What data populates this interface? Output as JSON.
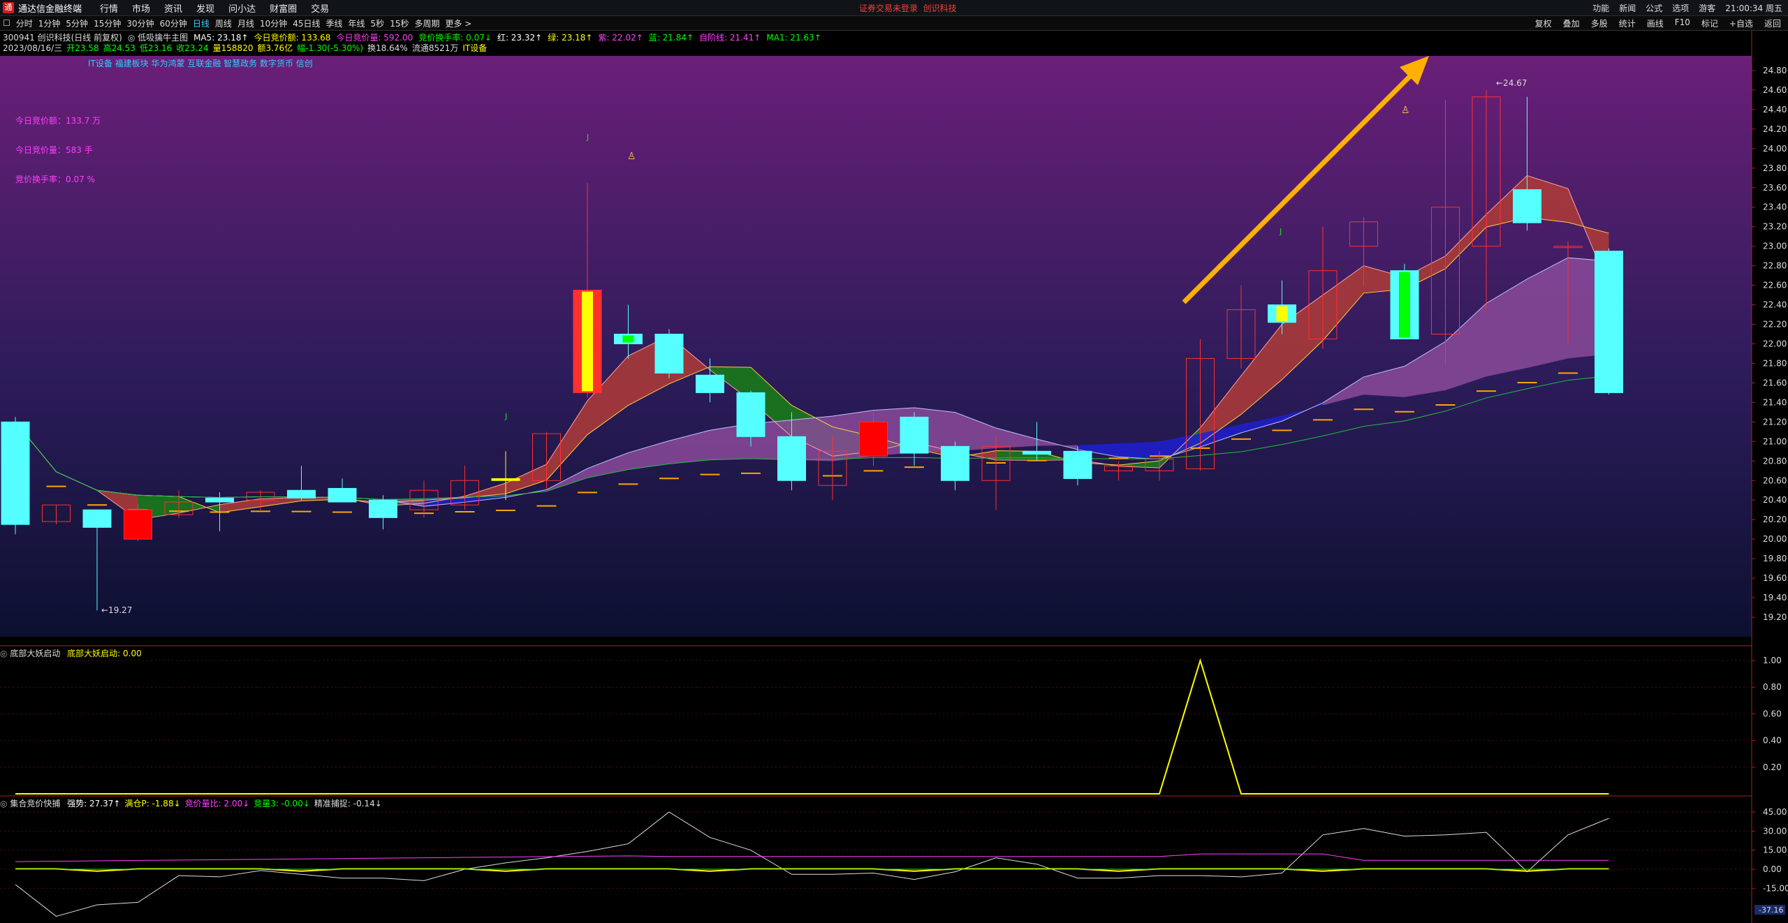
{
  "app": {
    "title": "通达信金融终端",
    "menu": [
      "行情",
      "市场",
      "资讯",
      "发现",
      "问小达",
      "财富圈",
      "交易"
    ],
    "notice": "证券交易未登录",
    "notice2": "创识科技",
    "right_items": [
      "功能",
      "新闻",
      "公式",
      "选项",
      "游客",
      "21:00:34 周五"
    ]
  },
  "periods": {
    "items": [
      "分时",
      "1分钟",
      "5分钟",
      "15分钟",
      "30分钟",
      "60分钟",
      "日线",
      "周线",
      "月线",
      "10分钟",
      "45日线",
      "季线",
      "年线",
      "5秒",
      "15秒",
      "多周期",
      "更多 >"
    ],
    "selected": "日线",
    "right": [
      "复权",
      "叠加",
      "多股",
      "统计",
      "画线",
      "F10",
      "标记",
      "+自选",
      "返回"
    ]
  },
  "info": {
    "line1": [
      {
        "text": "300941 创识科技(日线 前复权)",
        "color": "#dddddd"
      },
      {
        "text": "◎ 低吸擒牛主图",
        "color": "#dddddd"
      },
      {
        "text": "MA5: 23.18↑",
        "color": "#ffffff"
      },
      {
        "text": "今日竞价额: 133.68",
        "color": "#ffff00"
      },
      {
        "text": "今日竞价量: 592.00",
        "color": "#ff40ff"
      },
      {
        "text": "竞价换手率: 0.07↓",
        "color": "#00ff00"
      },
      {
        "text": "红: 23.32↑",
        "color": "#ffffff"
      },
      {
        "text": "绿: 23.18↑",
        "color": "#ffff00"
      },
      {
        "text": "紫: 22.02↑",
        "color": "#ff40ff"
      },
      {
        "text": "蓝: 21.84↑",
        "color": "#00ff00"
      },
      {
        "text": "自阶线: 21.41↑",
        "color": "#ff40ff"
      },
      {
        "text": "MA1: 21.63↑",
        "color": "#00ff00"
      }
    ],
    "line2": [
      {
        "text": "2023/08/16/三",
        "color": "#dddddd"
      },
      {
        "text": "开23.58",
        "color": "#00ff00"
      },
      {
        "text": "高24.53",
        "color": "#00ff00"
      },
      {
        "text": "低23.16",
        "color": "#00ff00"
      },
      {
        "text": "收23.24",
        "color": "#00ff00"
      },
      {
        "text": "量158820",
        "color": "#ffff00"
      },
      {
        "text": "额3.76亿",
        "color": "#ffff00"
      },
      {
        "text": "幅-1.30(-5.30%)",
        "color": "#00ff00"
      },
      {
        "text": "换18.64%",
        "color": "#dddddd"
      },
      {
        "text": "流通8521万",
        "color": "#dddddd"
      },
      {
        "text": "IT设备",
        "color": "#ffff00"
      }
    ],
    "concepts": "IT设备 福建板块 华为鸿蒙 互联金融 智慧政务 数字货币 信创"
  },
  "side_stats": [
    {
      "label": "今日竞价额：133.7 万"
    },
    {
      "label": "今日竞价量：583 手"
    },
    {
      "label": "竞价换手率：0.07 %"
    }
  ],
  "main_chart": {
    "ylim": [
      19.0,
      24.95
    ],
    "y_ticks": [
      "24.80",
      "24.60",
      "24.40",
      "24.20",
      "24.00",
      "23.80",
      "23.60",
      "23.40",
      "23.20",
      "23.00",
      "22.80",
      "22.60",
      "22.40",
      "22.20",
      "22.00",
      "21.80",
      "21.60",
      "21.40",
      "21.20",
      "21.00",
      "20.80",
      "20.60",
      "20.40",
      "20.20",
      "20.00",
      "19.80",
      "19.60",
      "19.40",
      "19.20"
    ],
    "high_label": "24.67",
    "low_label": "19.27",
    "candles": [
      {
        "o": 20.15,
        "h": 21.25,
        "l": 20.05,
        "c": 21.2,
        "col": "cyan"
      },
      {
        "o": 20.35,
        "h": 20.35,
        "l": 20.15,
        "c": 20.18,
        "col": "red"
      },
      {
        "o": 20.3,
        "h": 20.3,
        "l": 19.27,
        "c": 20.12,
        "col": "cyan"
      },
      {
        "o": 20.0,
        "h": 20.36,
        "l": 19.98,
        "c": 20.3,
        "col": "redfill"
      },
      {
        "o": 20.25,
        "h": 20.5,
        "l": 20.22,
        "c": 20.38,
        "col": "red"
      },
      {
        "o": 20.42,
        "h": 20.48,
        "l": 20.08,
        "c": 20.38,
        "col": "cyan"
      },
      {
        "o": 20.4,
        "h": 20.5,
        "l": 20.3,
        "c": 20.48,
        "col": "red"
      },
      {
        "o": 20.5,
        "h": 20.75,
        "l": 20.4,
        "c": 20.42,
        "col": "cyan"
      },
      {
        "o": 20.52,
        "h": 20.62,
        "l": 20.4,
        "c": 20.38,
        "col": "cyan"
      },
      {
        "o": 20.4,
        "h": 20.45,
        "l": 20.1,
        "c": 20.22,
        "col": "cyan"
      },
      {
        "o": 20.3,
        "h": 20.6,
        "l": 20.22,
        "c": 20.5,
        "col": "red"
      },
      {
        "o": 20.35,
        "h": 20.75,
        "l": 20.3,
        "c": 20.6,
        "col": "red"
      },
      {
        "o": 20.6,
        "h": 20.9,
        "l": 20.4,
        "c": 20.62,
        "col": "yellow"
      },
      {
        "o": 20.6,
        "h": 21.1,
        "l": 20.5,
        "c": 21.08,
        "col": "red"
      },
      {
        "o": 21.5,
        "h": 23.65,
        "l": 21.45,
        "c": 22.55,
        "col": "yellowfill"
      },
      {
        "o": 22.1,
        "h": 22.4,
        "l": 21.85,
        "c": 22.0,
        "col": "greenfill"
      },
      {
        "o": 22.1,
        "h": 22.15,
        "l": 21.65,
        "c": 21.7,
        "col": "cyan"
      },
      {
        "o": 21.68,
        "h": 21.85,
        "l": 21.4,
        "c": 21.5,
        "col": "cyan"
      },
      {
        "o": 21.5,
        "h": 21.52,
        "l": 20.95,
        "c": 21.05,
        "col": "cyan"
      },
      {
        "o": 21.05,
        "h": 21.3,
        "l": 20.5,
        "c": 20.6,
        "col": "cyan"
      },
      {
        "o": 20.55,
        "h": 21.05,
        "l": 20.4,
        "c": 20.9,
        "col": "red"
      },
      {
        "o": 20.85,
        "h": 21.3,
        "l": 20.75,
        "c": 21.2,
        "col": "redfill"
      },
      {
        "o": 21.25,
        "h": 21.3,
        "l": 20.75,
        "c": 20.88,
        "col": "cyan"
      },
      {
        "o": 20.95,
        "h": 21.0,
        "l": 20.5,
        "c": 20.6,
        "col": "cyan"
      },
      {
        "o": 20.6,
        "h": 21.05,
        "l": 20.3,
        "c": 20.95,
        "col": "red"
      },
      {
        "o": 20.9,
        "h": 21.2,
        "l": 20.8,
        "c": 20.87,
        "col": "cyan"
      },
      {
        "o": 20.9,
        "h": 20.95,
        "l": 20.55,
        "c": 20.62,
        "col": "cyan"
      },
      {
        "o": 20.7,
        "h": 20.8,
        "l": 20.6,
        "c": 20.75,
        "col": "red"
      },
      {
        "o": 20.7,
        "h": 20.9,
        "l": 20.6,
        "c": 20.82,
        "col": "red"
      },
      {
        "o": 20.72,
        "h": 22.05,
        "l": 20.7,
        "c": 21.85,
        "col": "red"
      },
      {
        "o": 21.85,
        "h": 22.6,
        "l": 21.75,
        "c": 22.35,
        "col": "red"
      },
      {
        "o": 22.22,
        "h": 22.65,
        "l": 22.1,
        "c": 22.4,
        "col": "cyanyellow"
      },
      {
        "o": 22.05,
        "h": 23.2,
        "l": 21.95,
        "c": 22.75,
        "col": "red"
      },
      {
        "o": 23.0,
        "h": 23.3,
        "l": 22.6,
        "c": 23.25,
        "col": "red"
      },
      {
        "o": 22.75,
        "h": 22.82,
        "l": 22.05,
        "c": 22.05,
        "col": "cyangreen"
      },
      {
        "o": 22.1,
        "h": 24.5,
        "l": 21.78,
        "c": 23.4,
        "col": "red"
      },
      {
        "o": 23.0,
        "h": 24.6,
        "l": 22.35,
        "c": 24.53,
        "col": "red"
      },
      {
        "o": 23.58,
        "h": 24.53,
        "l": 23.16,
        "c": 23.24,
        "col": "cyan"
      },
      {
        "o": 23.0,
        "h": 23.05,
        "l": 22.0,
        "c": 23.0,
        "col": "red"
      },
      {
        "o": 22.95,
        "h": 22.98,
        "l": 21.48,
        "c": 21.5,
        "col": "cyan"
      }
    ]
  },
  "panel2": {
    "title": "底部大妖启动",
    "value": "底部大妖启动: 0.00",
    "y_ticks": [
      "1.00",
      "0.80",
      "0.60",
      "0.40",
      "0.20"
    ]
  },
  "panel3": {
    "title": "集合竞价快捕",
    "items": [
      {
        "text": "强势: 27.37↑",
        "color": "#ffffff"
      },
      {
        "text": "满仓P: -1.88↓",
        "color": "#ffff00"
      },
      {
        "text": "竞价量比: 2.00↓",
        "color": "#ff40ff"
      },
      {
        "text": "竞量3: -0.00↓",
        "color": "#00ff00"
      },
      {
        "text": "精准捕捉: -0.14↓",
        "color": "#dddddd"
      }
    ],
    "y_ticks": [
      "45.00",
      "30.00",
      "15.00",
      "0.00",
      "-15.00"
    ],
    "bottom_value": "-37.16"
  }
}
